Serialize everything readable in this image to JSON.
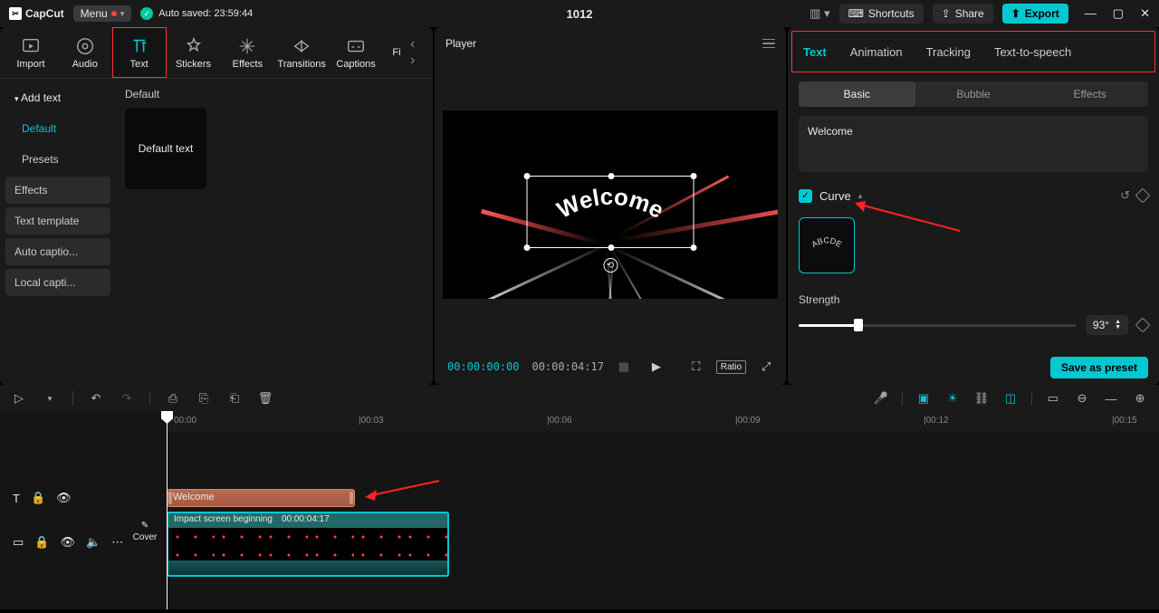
{
  "brand": "CapCut",
  "menu_label": "Menu",
  "autosave_label": "Auto saved: 23:59:44",
  "project_title": "1012",
  "shortcuts_label": "Shortcuts",
  "share_label": "Share",
  "export_label": "Export",
  "tool_tabs": {
    "import": "Import",
    "audio": "Audio",
    "text": "Text",
    "stickers": "Stickers",
    "effects": "Effects",
    "transitions": "Transitions",
    "captions": "Captions",
    "filters": "Fi"
  },
  "sidebar": {
    "add_text": "Add text",
    "default": "Default",
    "presets": "Presets",
    "effects": "Effects",
    "text_template": "Text template",
    "auto_captions": "Auto captio...",
    "local_captions": "Local capti..."
  },
  "content_header": "Default",
  "thumb_label": "Default text",
  "player": {
    "title": "Player",
    "welcome": "Welcome",
    "current": "00:00:00:00",
    "duration": "00:00:04:17",
    "ratio": "Ratio"
  },
  "right": {
    "tabs": {
      "text": "Text",
      "animation": "Animation",
      "tracking": "Tracking",
      "tts": "Text-to-speech"
    },
    "sub": {
      "basic": "Basic",
      "bubble": "Bubble",
      "effects": "Effects"
    },
    "text_value": "Welcome",
    "curve_label": "Curve",
    "preset_label": "ABCDE",
    "strength_label": "Strength",
    "strength_value": "93°",
    "save_preset": "Save as preset"
  },
  "timeline": {
    "ticks": [
      "00:00",
      "|00:03",
      "|00:06",
      "|00:09",
      "|00:12",
      "|00:15"
    ],
    "text_clip": "Welcome",
    "cover": "Cover",
    "vid_name": "Impact screen beginning",
    "vid_dur": "00:00:04:17"
  }
}
